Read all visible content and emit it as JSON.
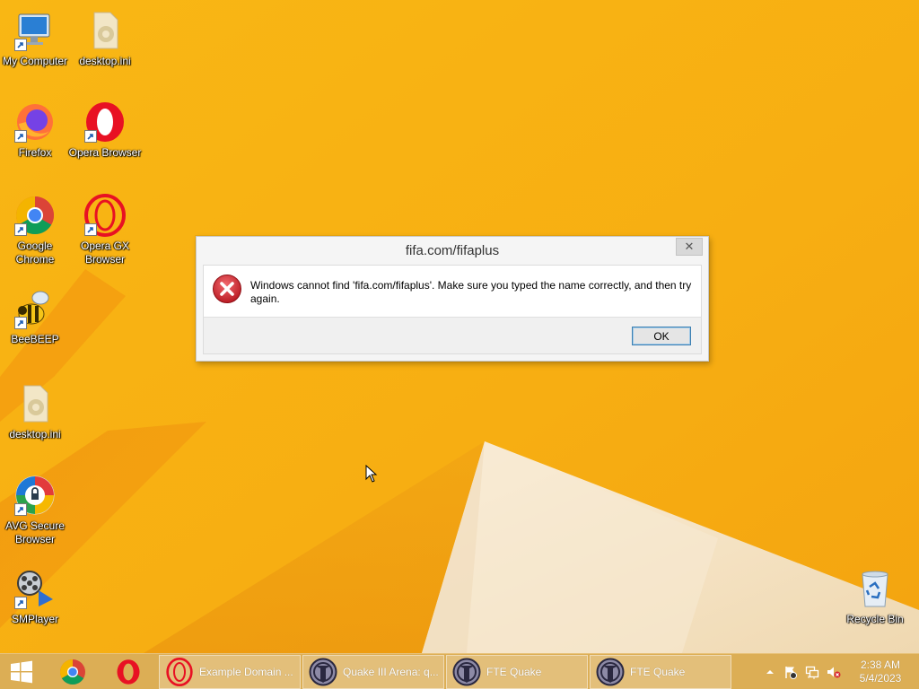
{
  "desktop": {
    "icons": [
      {
        "label": "My Computer",
        "icon": "computer-icon"
      },
      {
        "label": "desktop.ini",
        "icon": "settings-file-icon"
      },
      {
        "label": "Firefox",
        "icon": "firefox-icon"
      },
      {
        "label": "Opera Browser",
        "icon": "opera-icon"
      },
      {
        "label": "Google Chrome",
        "icon": "chrome-icon"
      },
      {
        "label": "Opera GX Browser",
        "icon": "opera-gx-icon"
      },
      {
        "label": "BeeBEEP",
        "icon": "bee-icon"
      },
      {
        "label": "desktop.ini",
        "icon": "settings-file-icon"
      },
      {
        "label": "AVG Secure Browser",
        "icon": "avg-browser-icon"
      },
      {
        "label": "SMPlayer",
        "icon": "smplayer-icon"
      },
      {
        "label": "Recycle Bin",
        "icon": "recycle-bin-icon"
      }
    ]
  },
  "dialog": {
    "title": "fifa.com/fifaplus",
    "close_glyph": "✕",
    "message": "Windows cannot find 'fifa.com/fifaplus'. Make sure you typed the name correctly, and then try again.",
    "ok_label": "OK",
    "icon": "error-icon"
  },
  "taskbar": {
    "start_icon": "windows-logo-icon",
    "pinned": [
      {
        "name": "Google Chrome",
        "icon": "chrome-icon"
      },
      {
        "name": "Opera",
        "icon": "opera-icon"
      }
    ],
    "tasks": [
      {
        "label": "Example Domain ...",
        "icon": "opera-icon"
      },
      {
        "label": "Quake III Arena: q...",
        "icon": "quake-icon"
      },
      {
        "label": "FTE Quake",
        "icon": "quake-icon"
      },
      {
        "label": "FTE Quake",
        "icon": "quake-icon"
      }
    ],
    "tray": {
      "icons": [
        "chevron-up-icon",
        "action-center-flag-icon",
        "network-icon",
        "speaker-muted-icon"
      ],
      "time": "2:38 AM",
      "date": "5/4/2023"
    }
  },
  "colors": {
    "wallpaper_base": "#f7ad12",
    "wallpaper_dark": "#ee8c0c",
    "wallpaper_light": "#f4e6cc",
    "taskbar": "#dcae55",
    "error_red": "#c6212a",
    "ok_border": "#3c7fb1"
  }
}
